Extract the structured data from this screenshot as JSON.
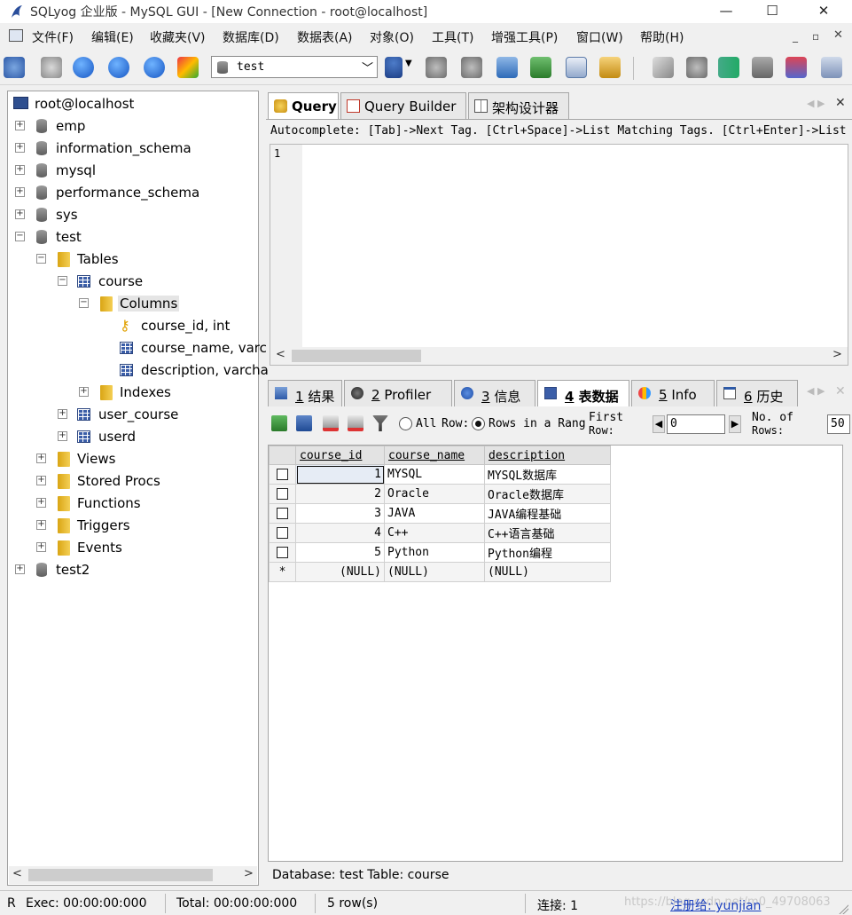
{
  "window": {
    "title": "SQLyog 企业版 - MySQL GUI - [New Connection - root@localhost]",
    "controls": [
      "—",
      "☐",
      "✕"
    ]
  },
  "menubar": [
    "文件(F)",
    "编辑(E)",
    "收藏夹(V)",
    "数据库(D)",
    "数据表(A)",
    "对象(O)",
    "工具(T)",
    "增强工具(P)",
    "窗口(W)",
    "帮助(H)"
  ],
  "toolbar": {
    "database_selector": "test"
  },
  "tree": {
    "root": "root@localhost",
    "databases": [
      "emp",
      "information_schema",
      "mysql",
      "performance_schema",
      "sys",
      "test"
    ],
    "tables_folder": "Tables",
    "table_course": "course",
    "columns_folder": "Columns",
    "columns": [
      "course_id, int",
      "course_name, varc",
      "description, varcha"
    ],
    "indexes": "Indexes",
    "other_tables": [
      "user_course",
      "userd"
    ],
    "folders": [
      "Views",
      "Stored Procs",
      "Functions",
      "Triggers",
      "Events"
    ],
    "last_db": "test2"
  },
  "query_tabs": [
    "Query",
    "Query Builder",
    "架构设计器"
  ],
  "autocomplete": "Autocomplete: [Tab]->Next Tag. [Ctrl+Space]->List Matching Tags. [Ctrl+Enter]->List Al...",
  "editor": {
    "line_number": "1"
  },
  "result_tabs": [
    {
      "key": "1",
      "label": "结果"
    },
    {
      "key": "2",
      "label": "Profiler"
    },
    {
      "key": "3",
      "label": "信息"
    },
    {
      "key": "4",
      "label": "表数据"
    },
    {
      "key": "5",
      "label": "Info"
    },
    {
      "key": "6",
      "label": "历史"
    }
  ],
  "grid_toolbar": {
    "all": "All",
    "row": "Row:",
    "rows_in_range": "Rows in a Rang",
    "first": "First",
    "row2": "Row:",
    "first_value": "0",
    "no_of": "No. of",
    "rows": "Rows:",
    "count_value": "50"
  },
  "grid": {
    "columns": [
      "course_id",
      "course_name",
      "description"
    ],
    "rows": [
      [
        "1",
        "MYSQL",
        "MYSQL数据库"
      ],
      [
        "2",
        "Oracle",
        "Oracle数据库"
      ],
      [
        "3",
        "JAVA",
        "JAVA编程基础"
      ],
      [
        "4",
        "C++",
        "C++语言基础"
      ],
      [
        "5",
        "Python",
        "Python编程"
      ]
    ],
    "new_row": [
      "(NULL)",
      "(NULL)",
      "(NULL)"
    ],
    "new_row_marker": "*"
  },
  "db_info": "Database: test Table: course",
  "status": {
    "mode": "R",
    "exec": "Exec: 00:00:00:000",
    "total": "Total: 00:00:00:000",
    "rows": "5 row(s)",
    "connection": "连接: 1",
    "register": "注册给: yunjian",
    "watermark": "https://blog.csdn.net/m0_49708063"
  }
}
